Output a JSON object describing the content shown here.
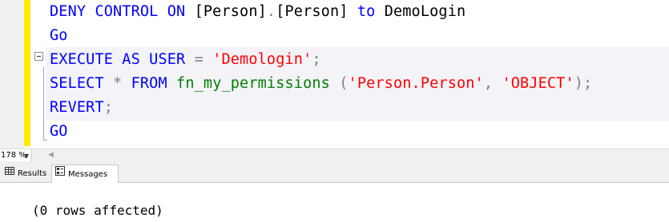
{
  "editor": {
    "lines": [
      [
        {
          "t": "DENY CONTROL ON ",
          "c": "kw"
        },
        {
          "t": "[Person]",
          "c": "ident"
        },
        {
          "t": ".",
          "c": "punct"
        },
        {
          "t": "[Person] ",
          "c": "ident"
        },
        {
          "t": "to ",
          "c": "kw"
        },
        {
          "t": "DemoLogin",
          "c": "ident"
        }
      ],
      [
        {
          "t": "Go",
          "c": "kw"
        }
      ],
      [
        {
          "t": "EXECUTE AS USER ",
          "c": "kw"
        },
        {
          "t": "= ",
          "c": "punct"
        },
        {
          "t": "'Demologin'",
          "c": "str"
        },
        {
          "t": ";",
          "c": "punct"
        }
      ],
      [
        {
          "t": "SELECT ",
          "c": "kw"
        },
        {
          "t": "* ",
          "c": "punct"
        },
        {
          "t": "FROM ",
          "c": "kw"
        },
        {
          "t": "fn_my_permissions ",
          "c": "fn"
        },
        {
          "t": "(",
          "c": "punct"
        },
        {
          "t": "'Person.Person'",
          "c": "str"
        },
        {
          "t": ", ",
          "c": "punct"
        },
        {
          "t": "'OBJECT'",
          "c": "str"
        },
        {
          "t": ");",
          "c": "punct"
        }
      ],
      [
        {
          "t": "REVERT",
          "c": "kw"
        },
        {
          "t": ";",
          "c": "punct"
        }
      ],
      [
        {
          "t": "GO",
          "c": "kw"
        }
      ]
    ]
  },
  "zoom": {
    "value": "178 %"
  },
  "tabs": {
    "results_label": "Results",
    "messages_label": "Messages",
    "active": "Messages"
  },
  "messages": {
    "text": "(0 rows affected)"
  },
  "colors": {
    "keyword": "#0000ff",
    "function": "#008000",
    "string": "#ff0000",
    "operator": "#808080",
    "change_bar": "#ffec00"
  }
}
